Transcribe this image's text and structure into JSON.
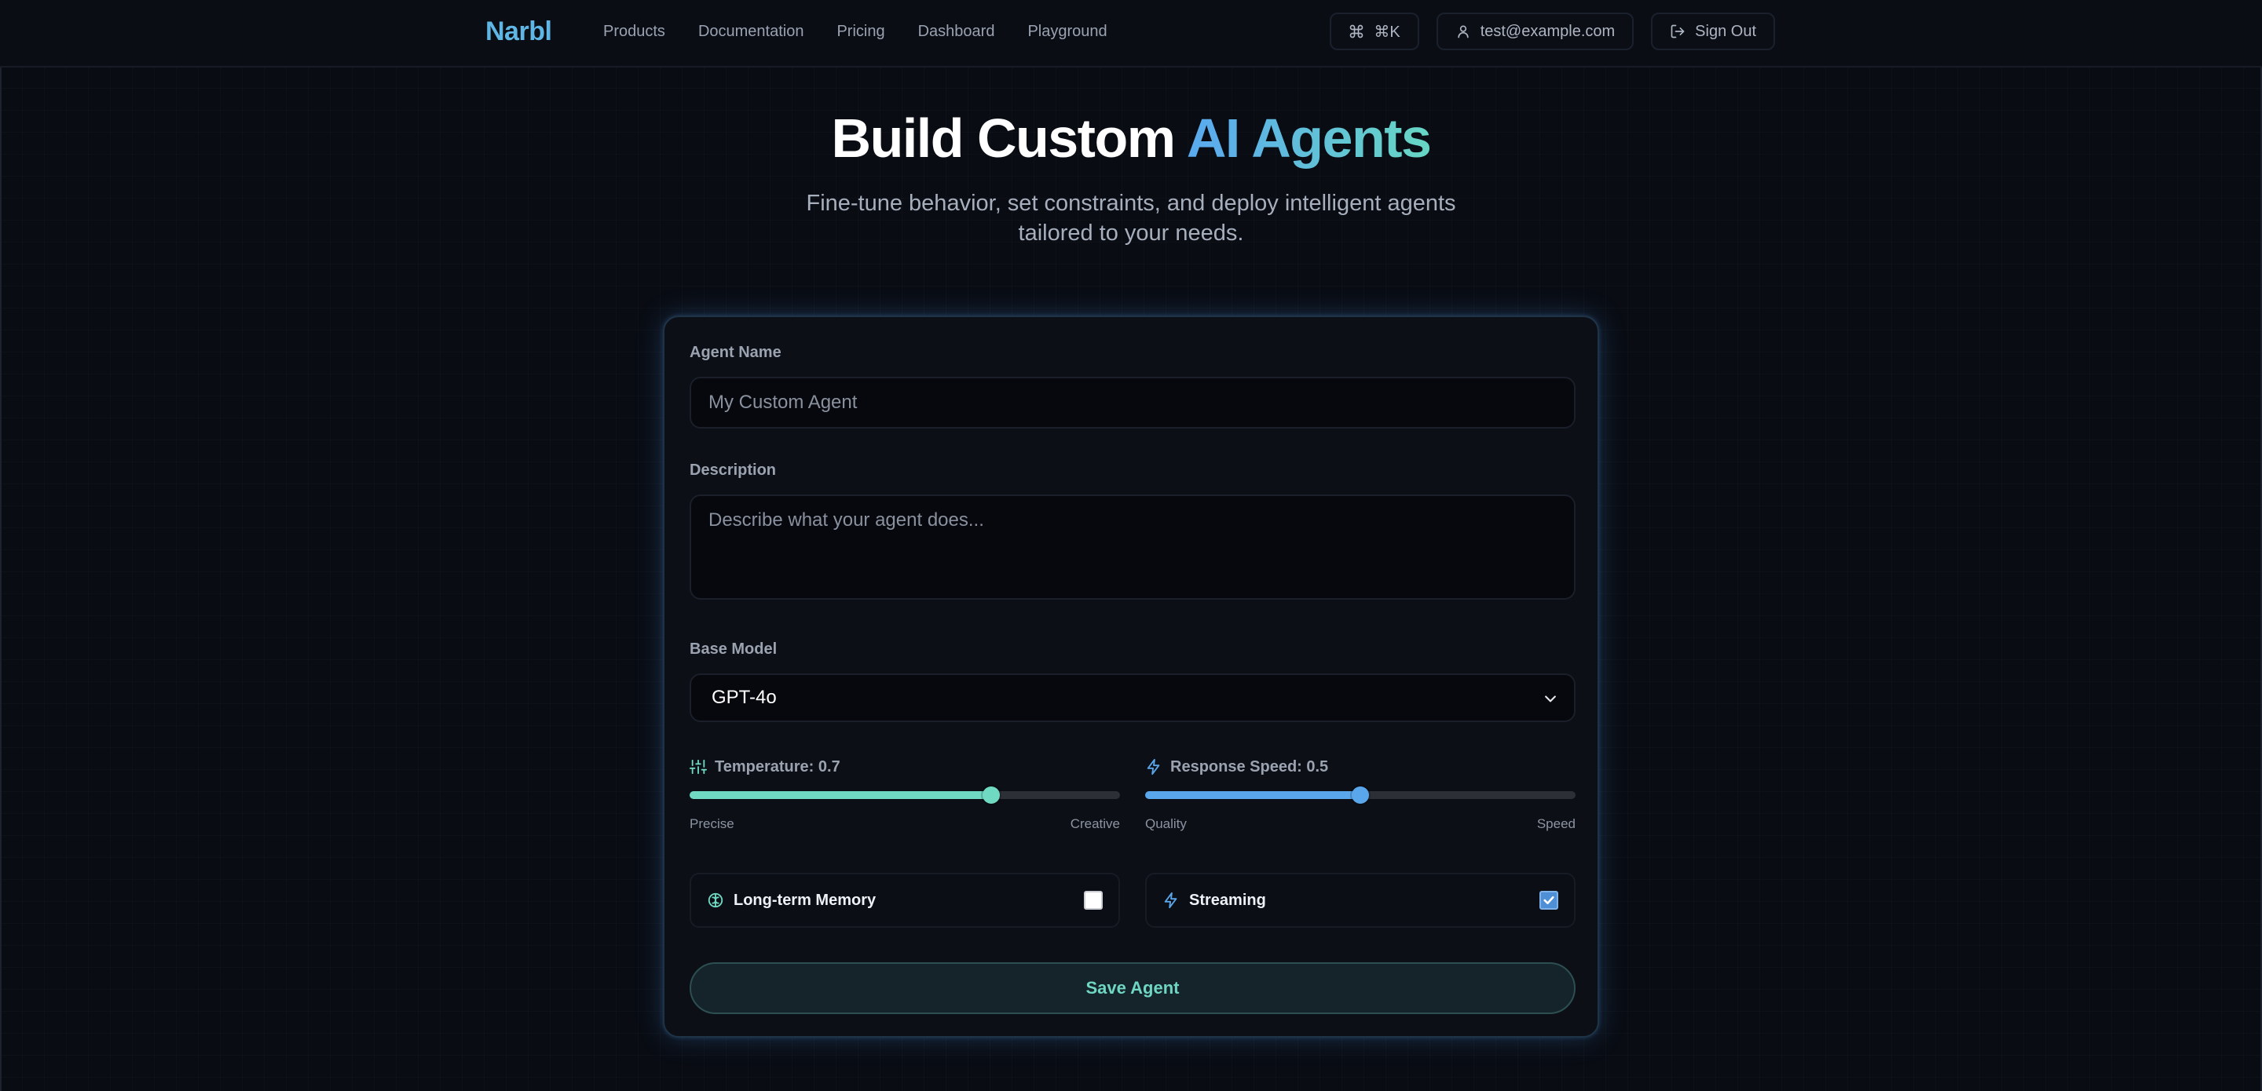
{
  "nav": {
    "brand": "Narbl",
    "links": [
      "Products",
      "Documentation",
      "Pricing",
      "Dashboard",
      "Playground"
    ],
    "command_shortcut": "⌘K",
    "user_email": "test@example.com",
    "sign_out": "Sign Out"
  },
  "hero": {
    "title_plain": "Build Custom ",
    "title_accent": "AI Agents",
    "subtitle_line1": "Fine-tune behavior, set constraints, and deploy intelligent agents",
    "subtitle_line2": "tailored to your needs."
  },
  "form": {
    "agent_name_label": "Agent Name",
    "agent_name_placeholder": "My Custom Agent",
    "description_label": "Description",
    "description_placeholder": "Describe what your agent does...",
    "base_model_label": "Base Model",
    "base_model_value": "GPT-4o",
    "temperature": {
      "label": "Temperature: 0.7",
      "value": 0.7,
      "min_label": "Precise",
      "max_label": "Creative",
      "color": "#6fd9c1"
    },
    "response_speed": {
      "label": "Response Speed: 0.5",
      "value": 0.5,
      "min_label": "Quality",
      "max_label": "Speed",
      "color": "#5aa6ea"
    },
    "long_term_memory": {
      "label": "Long-term Memory",
      "checked": false
    },
    "streaming": {
      "label": "Streaming",
      "checked": true
    },
    "save_label": "Save Agent"
  },
  "colors": {
    "brand": "#5fb6e4",
    "accent_teal": "#6fd6c3",
    "accent_blue": "#5aa6ea",
    "background": "#090c13"
  }
}
